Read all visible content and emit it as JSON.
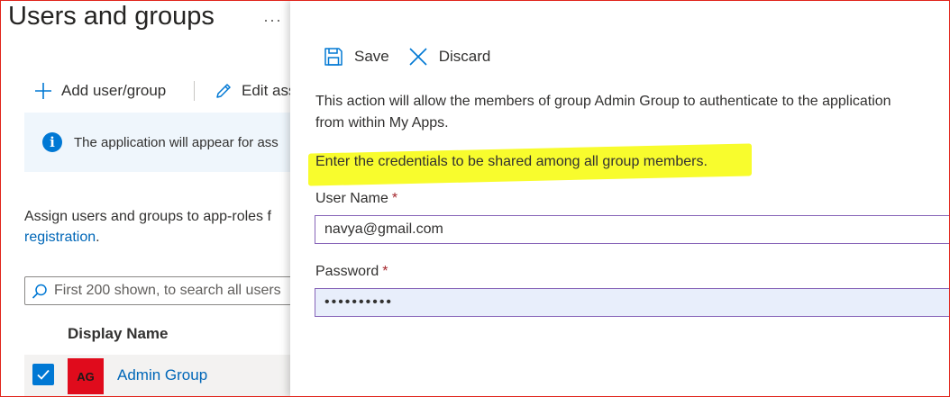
{
  "page": {
    "title": "Users and groups",
    "more": "···"
  },
  "commands": {
    "add_label": "Add user/group",
    "edit_label": "Edit ass"
  },
  "info": {
    "text": "The application will appear for ass"
  },
  "assign": {
    "line1": "Assign users and groups to app-roles f",
    "link": "registration",
    "line2_suffix": "."
  },
  "search": {
    "placeholder": "First 200 shown, to search all users"
  },
  "table": {
    "header": "Display Name",
    "rows": [
      {
        "initials": "AG",
        "name": "Admin Group",
        "checked": true
      }
    ]
  },
  "panel": {
    "save_label": "Save",
    "discard_label": "Discard",
    "description_line1": "This action will allow the members of group Admin Group to authenticate to the application",
    "description_line2": "from within My Apps.",
    "highlight_text": "Enter the credentials to be shared among all group members.",
    "username_label": "User Name",
    "username_value": "navya@gmail.com",
    "password_label": "Password",
    "password_value": "••••••••••",
    "required_mark": "*"
  },
  "colors": {
    "accent": "#0078d4",
    "link": "#0067b8",
    "avatar_bg": "#e00b1c",
    "highlight": "#f8fc2d",
    "field_border": "#8764b8",
    "frame": "#e0241b"
  }
}
